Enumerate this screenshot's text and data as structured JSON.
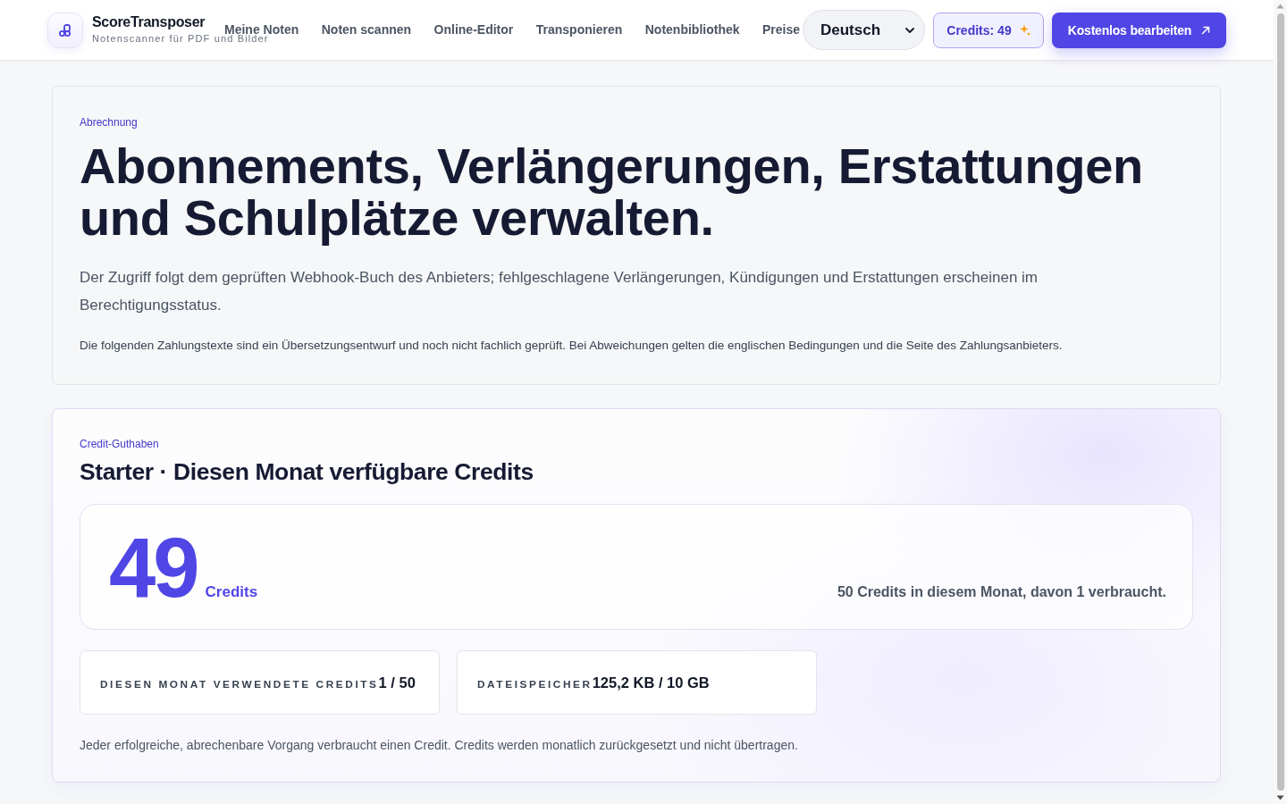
{
  "header": {
    "brand": {
      "name": "ScoreTransposer",
      "tagline": "Notenscanner für PDF und Bilder"
    },
    "nav": [
      {
        "label": "Meine Noten"
      },
      {
        "label": "Noten scannen"
      },
      {
        "label": "Online-Editor"
      },
      {
        "label": "Transponieren"
      },
      {
        "label": "Notenbibliothek"
      },
      {
        "label": "Preise"
      }
    ],
    "language_select": {
      "value": "Deutsch"
    },
    "credits_button": {
      "label": "Credits: 49"
    },
    "cta_button": {
      "label": "Kostenlos bearbeiten"
    }
  },
  "billing_intro": {
    "eyebrow": "Abrechnung",
    "title": "Abonnements, Verlängerungen, Erstattungen und Schulplätze verwalten.",
    "description": "Der Zugriff folgt dem geprüften Webhook-Buch des Anbieters; fehlgeschlagene Verlängerungen, Kündigungen und Erstattungen erscheinen im Berechtigungsstatus.",
    "note": "Die folgenden Zahlungstexte sind ein Übersetzungsentwurf und noch nicht fachlich geprüft. Bei Abweichungen gelten die englischen Bedingungen und die Seite des Zahlungsanbieters."
  },
  "credit_balance": {
    "eyebrow": "Credit-Guthaben",
    "title": "Starter · Diesen Monat verfügbare Credits",
    "amount": "49",
    "unit": "Credits",
    "summary": "50 Credits in diesem Monat, davon 1 verbraucht.",
    "stats": [
      {
        "label": "DIESEN MONAT VERWENDETE CREDITS",
        "value": "1 / 50"
      },
      {
        "label": "DATEISPEICHER",
        "value": "125,2 KB / 10 GB"
      }
    ],
    "footnote": "Jeder erfolgreiche, abrechenbare Vorgang verbraucht einen Credit. Credits werden monatlich zurückgesetzt und nicht übertragen."
  }
}
